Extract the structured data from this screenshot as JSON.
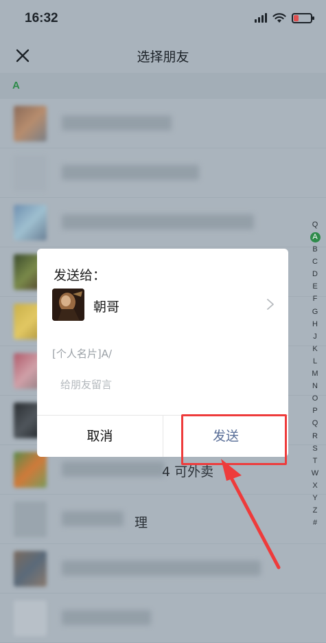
{
  "status_bar": {
    "time": "16:32",
    "icons": [
      "cellular-signal-icon",
      "wifi-icon",
      "battery-low-icon"
    ],
    "battery_color": "#e05050"
  },
  "header": {
    "title": "选择朋友",
    "close_icon": "close-icon"
  },
  "section": {
    "letter": "A",
    "accent": "#2e8b4a"
  },
  "contacts": {
    "visible_name_fragments": [
      "4 可外卖",
      "理"
    ]
  },
  "alpha_index": [
    "Q",
    "A",
    "B",
    "C",
    "D",
    "E",
    "F",
    "G",
    "H",
    "J",
    "K",
    "L",
    "M",
    "N",
    "O",
    "P",
    "Q",
    "R",
    "S",
    "T",
    "W",
    "X",
    "Y",
    "Z",
    "#"
  ],
  "alpha_index_active": "A",
  "dialog": {
    "title": "发送给：",
    "recipient_name": "朝哥",
    "card_label": "[个人名片]A/",
    "message_placeholder": "给朋友留言",
    "cancel_label": "取消",
    "send_label": "发送",
    "send_color": "#5a6f98"
  },
  "annotation": {
    "color": "#ee3b3b"
  }
}
